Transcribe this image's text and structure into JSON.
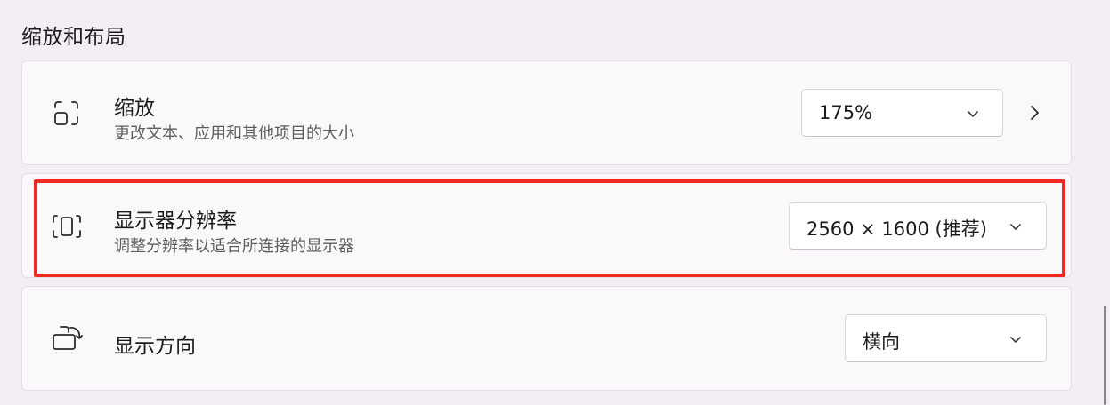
{
  "section": {
    "title": "缩放和布局"
  },
  "zoom": {
    "title": "缩放",
    "description": "更改文本、应用和其他项目的大小",
    "value": "175%",
    "icon": "zoom-frame-icon"
  },
  "resolution": {
    "title": "显示器分辨率",
    "description": "调整分辨率以适合所连接的显示器",
    "value": "2560 × 1600 (推荐)",
    "icon": "resolution-frame-icon"
  },
  "orientation": {
    "title": "显示方向",
    "value": "横向",
    "icon": "rotate-display-icon"
  },
  "colors": {
    "highlight": "#ef2a22",
    "background": "#f3eef4",
    "card": "#fbf8fb"
  }
}
